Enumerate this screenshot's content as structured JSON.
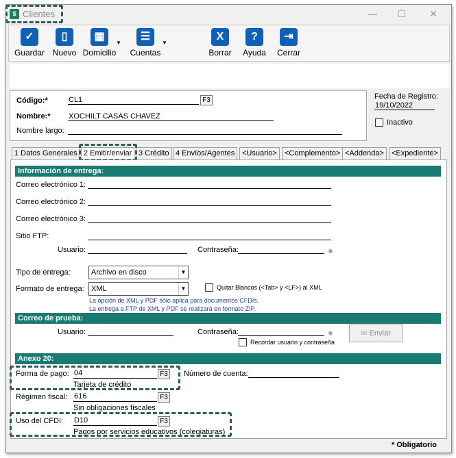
{
  "window": {
    "title": "Clientes",
    "min": "—",
    "max": "☐",
    "close": "✕"
  },
  "toolbar": [
    {
      "label": "Guardar",
      "icon": "✓"
    },
    {
      "label": "Nuevo",
      "icon": "▯"
    },
    {
      "label": "Domicilio",
      "icon": "▦"
    },
    {
      "label": "Cuentas",
      "icon": "☰"
    },
    {
      "label": "Borrar",
      "icon": "X"
    },
    {
      "label": "Ayuda",
      "icon": "?"
    },
    {
      "label": "Cerrar",
      "icon": "⇥"
    }
  ],
  "header": {
    "codigo_label": "Código:*",
    "codigo_value": "CL1",
    "f3": "F3",
    "nombre_label": "Nombre:*",
    "nombre_value": "XOCHILT CASAS CHAVEZ",
    "nombre_largo_label": "Nombre largo:",
    "nombre_largo_value": "",
    "fecha_label": "Fecha de Registro:",
    "fecha_value": "19/10/2022",
    "inactivo_label": "Inactivo",
    "inactivo_checked": false
  },
  "tabs": [
    "1 Datos Generales",
    "2 Emitir/enviar",
    "3 Crédito",
    "4 Envíos/Agentes",
    "<Usuario>",
    "<Complemento>",
    "<Addenda>",
    "<Expediente>"
  ],
  "entrega": {
    "section": "Información de entrega:",
    "correo1": "Correo electrónico 1:",
    "correo2": "Correo electrónico 2:",
    "correo3": "Correo electrónico 3:",
    "sitio_ftp": "Sitio FTP:",
    "usuario": "Usuario:",
    "contrasena": "Contraseña:",
    "tipo_label": "Tipo de entrega:",
    "tipo_value": "Archivo en disco",
    "formato_label": "Formato de entrega:",
    "formato_value": "XML",
    "quitar_blancos": "Quitar Blancos (<Tab> y <LF>) al  XML",
    "note1": "La opción de XML y PDF sólo aplica para documentos CFDIs.",
    "note2": "La entrega a FTP de XML y PDF se realizará en formato ZIP."
  },
  "prueba": {
    "section": "Correo de prueba:",
    "usuario": "Usuario:",
    "contrasena": "Contraseña:",
    "recordar": "Recordar usuario y contraseña",
    "enviar": "Enviar"
  },
  "anexo": {
    "section": "Anexo 20:",
    "forma_label": "Forma de pago:",
    "forma_value": "04",
    "forma_desc": "Tarjeta de crédito",
    "cuenta_label": "Número de cuenta:",
    "regimen_label": "Régimen fiscal:",
    "regimen_value": "616",
    "regimen_desc": "Sin obligaciones fiscales",
    "uso_label": "Uso del CFDI:",
    "uso_value": "D10",
    "uso_desc": "Pagos por servicios educativos (colegiaturas)"
  },
  "status": "* Obligatorio"
}
